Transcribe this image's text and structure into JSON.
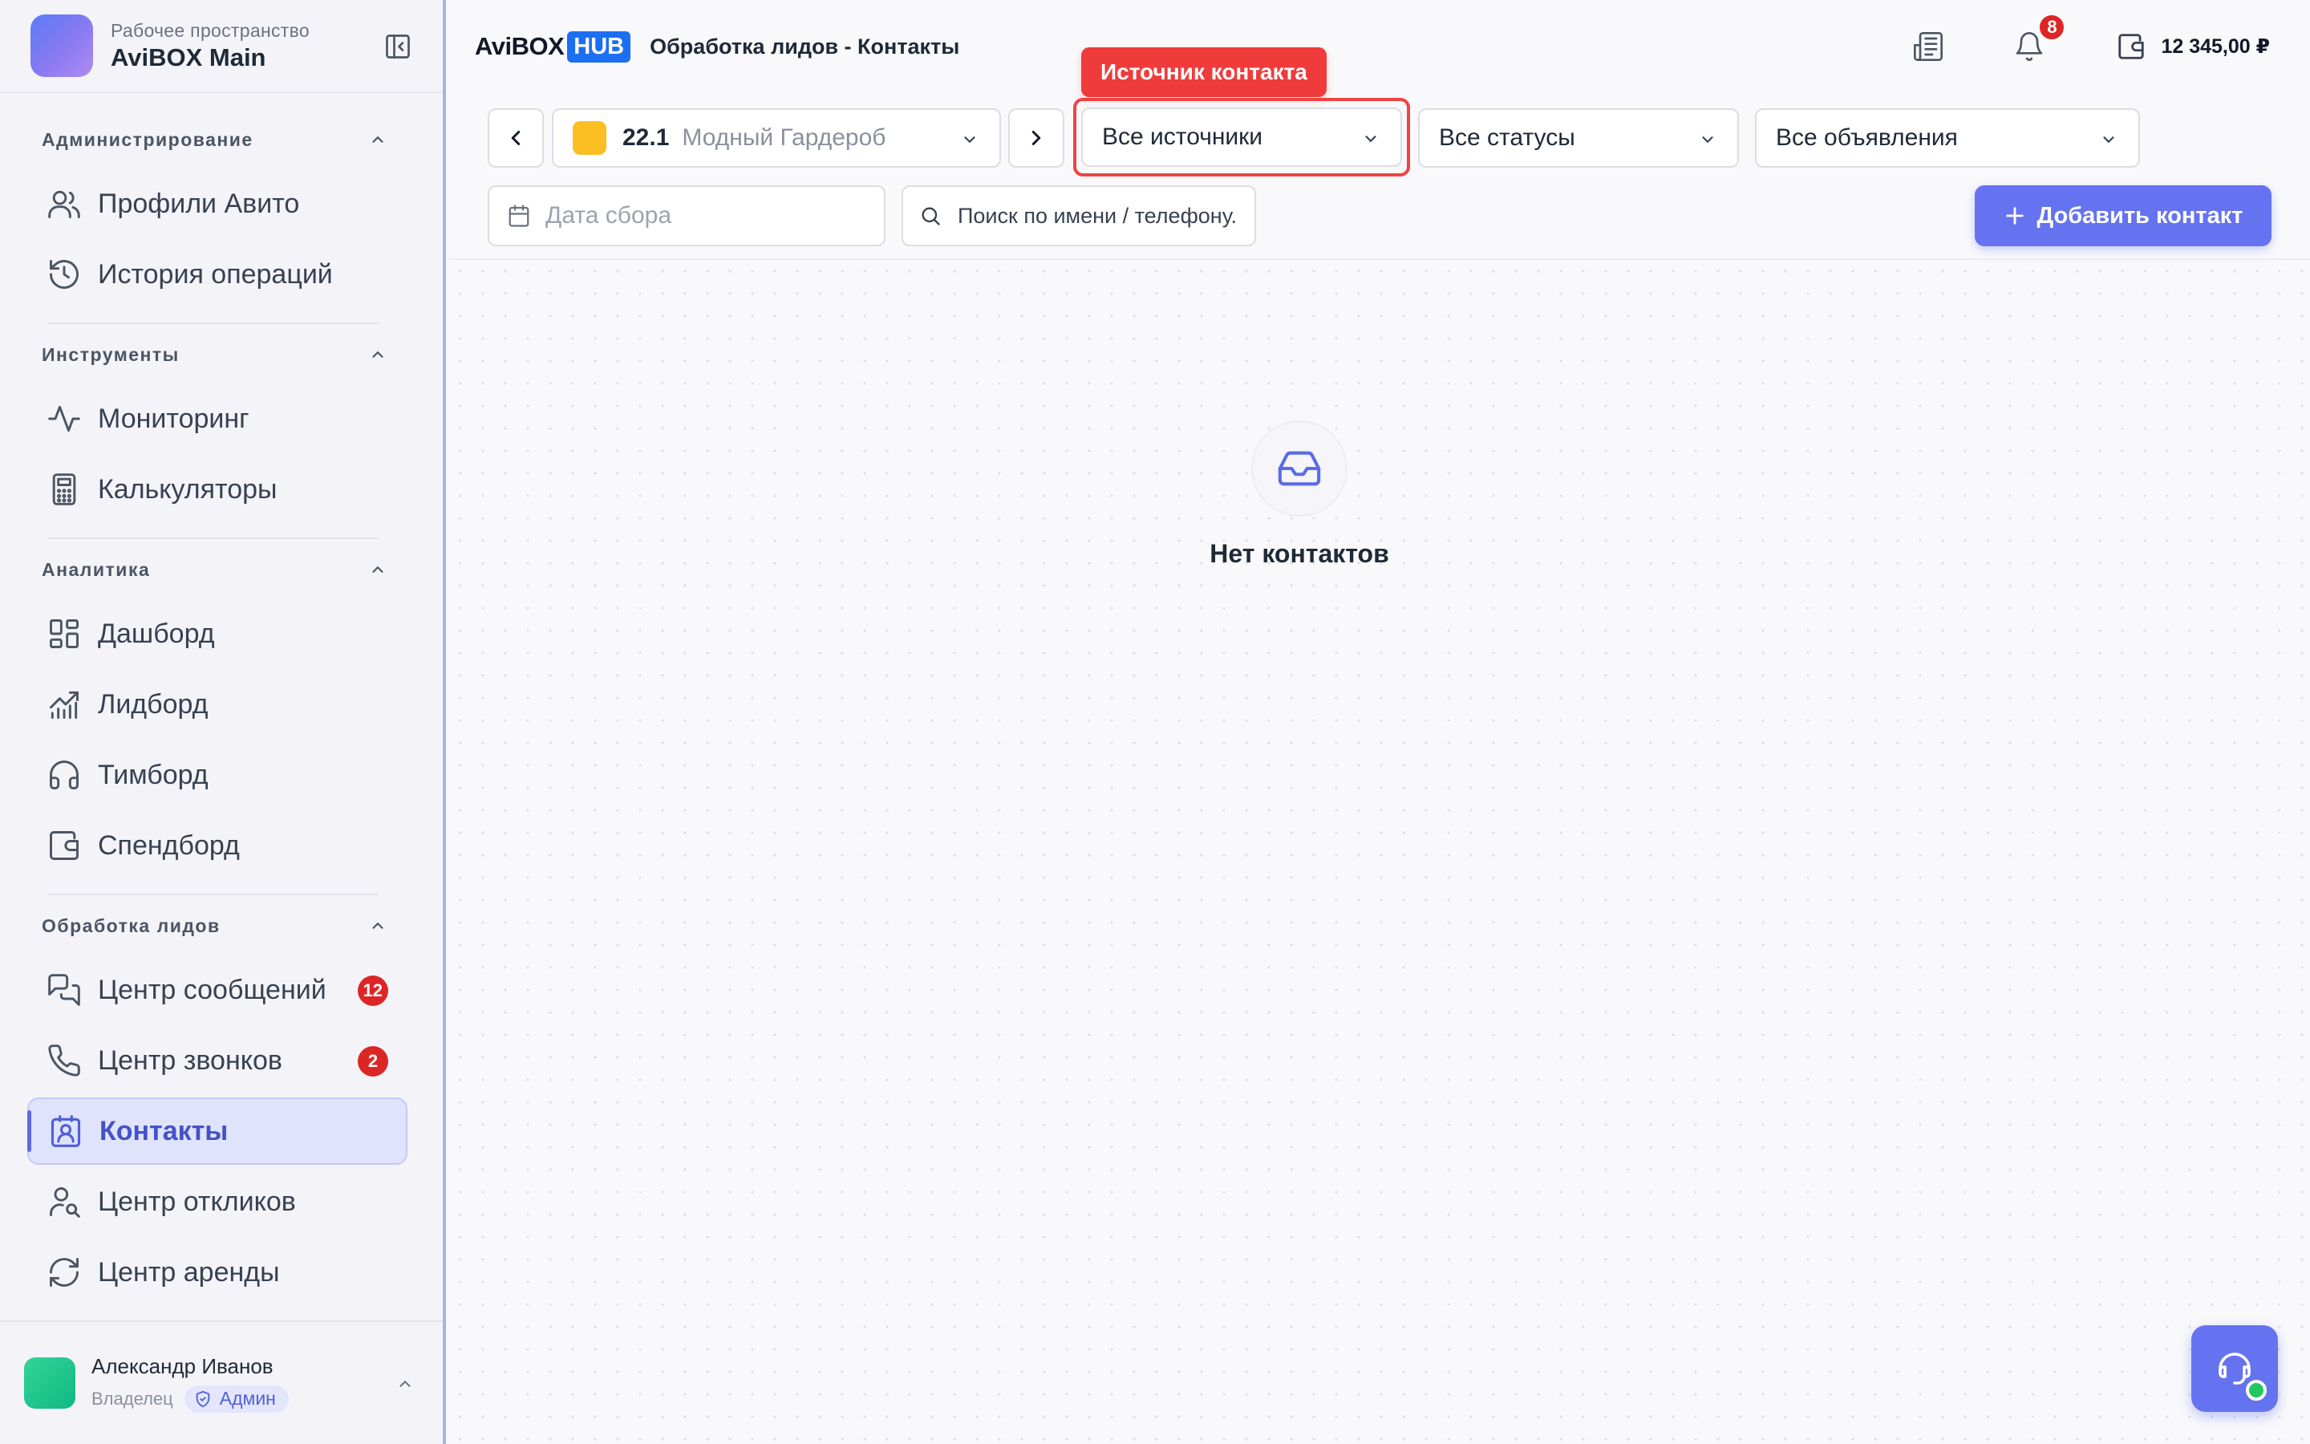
{
  "workspace": {
    "subtitle": "Рабочее пространство",
    "name": "AviBOX Main"
  },
  "sidebar": {
    "sections": [
      {
        "title": "Администрирование",
        "items": [
          {
            "label": "Профили Авито",
            "icon": "users-icon"
          },
          {
            "label": "История операций",
            "icon": "history-icon"
          }
        ]
      },
      {
        "title": "Инструменты",
        "items": [
          {
            "label": "Мониторинг",
            "icon": "activity-icon"
          },
          {
            "label": "Калькуляторы",
            "icon": "calculator-icon"
          }
        ]
      },
      {
        "title": "Аналитика",
        "items": [
          {
            "label": "Дашборд",
            "icon": "dashboard-icon"
          },
          {
            "label": "Лидборд",
            "icon": "chart-icon"
          },
          {
            "label": "Тимборд",
            "icon": "headphones-icon"
          },
          {
            "label": "Спендборд",
            "icon": "wallet-icon"
          }
        ]
      },
      {
        "title": "Обработка лидов",
        "items": [
          {
            "label": "Центр сообщений",
            "icon": "messages-icon",
            "badge": "12"
          },
          {
            "label": "Центр звонков",
            "icon": "phone-icon",
            "badge": "2"
          },
          {
            "label": "Контакты",
            "icon": "contact-icon",
            "active": true
          },
          {
            "label": "Центр откликов",
            "icon": "user-search-icon"
          },
          {
            "label": "Центр аренды",
            "icon": "refresh-icon"
          }
        ]
      }
    ]
  },
  "user": {
    "name": "Александр Иванов",
    "role": "Владелец",
    "badge": "Админ"
  },
  "topbar": {
    "brand_text": "AviBOX",
    "brand_hub": "HUB",
    "breadcrumb": "Обработка лидов - Контакты",
    "notifications_count": "8",
    "balance": "12 345,00 ₽"
  },
  "filters": {
    "profile_number": "22.1",
    "profile_name": "Модный Гардероб",
    "source_value": "Все источники",
    "source_tooltip": "Источник контакта",
    "status_value": "Все статусы",
    "ads_value": "Все объявления",
    "date_placeholder": "Дата сбора",
    "search_placeholder": "Поиск по имени / телефону.",
    "add_button": "Добавить контакт"
  },
  "empty_state": {
    "text": "Нет контактов"
  },
  "colors": {
    "accent": "#6573f0",
    "danger": "#ef4444",
    "badge": "#dc2626",
    "brand_hub": "#1d6ff2"
  }
}
